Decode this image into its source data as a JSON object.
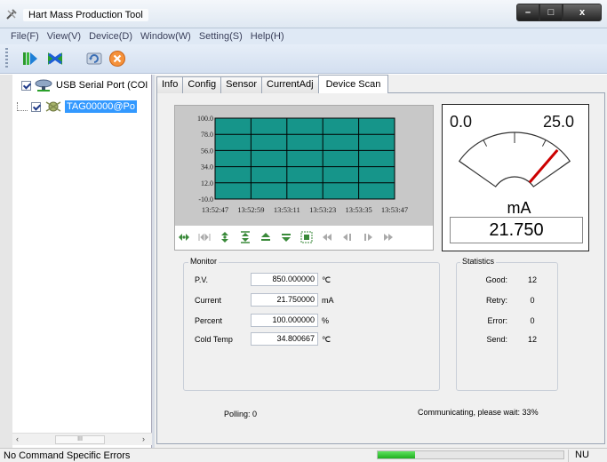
{
  "window": {
    "title": "Hart Mass Production Tool",
    "min": "–",
    "max": "□",
    "close": "x"
  },
  "menu": [
    "File(F)",
    "View(V)",
    "Device(D)",
    "Window(W)",
    "Setting(S)",
    "Help(H)"
  ],
  "toolbar": {
    "icons": [
      "connect-icon",
      "disconnect-icon",
      "refresh-icon",
      "stop-icon"
    ]
  },
  "tree": {
    "port": "USB Serial Port (COI",
    "device": "TAG00000@Po",
    "scroll_thumb": "III"
  },
  "tabs": [
    {
      "label": "Info"
    },
    {
      "label": "Config"
    },
    {
      "label": "Sensor"
    },
    {
      "label": "CurrentAdj"
    },
    {
      "label": "Device Scan"
    }
  ],
  "active_tab": 4,
  "chart_data": {
    "type": "area",
    "y_ticks": [
      "100.0",
      "78.0",
      "56.0",
      "34.0",
      "12.0",
      "-10.0"
    ],
    "x_ticks": [
      "13:52:47",
      "13:52:59",
      "13:53:11",
      "13:53:23",
      "13:53:35",
      "13:53:47"
    ],
    "ylim": [
      -10.0,
      100.0
    ],
    "grid": true,
    "fill_color": "#16958a",
    "series": [
      {
        "values": [
          100.0,
          100.0,
          100.0,
          100.0,
          100.0,
          100.0
        ]
      }
    ]
  },
  "gauge": {
    "min": "0.0",
    "max": "25.0",
    "unit": "mA",
    "value": "21.750",
    "value_num": 21.75,
    "needle_color": "#cc0000"
  },
  "monitor": {
    "title": "Monitor",
    "rows": [
      {
        "label": "P.V.",
        "value": "850.000000",
        "unit": "℃"
      },
      {
        "label": "Current",
        "value": "21.750000",
        "unit": "mA"
      },
      {
        "label": "Percent",
        "value": "100.000000",
        "unit": "%"
      },
      {
        "label": "Cold Temp",
        "value": "34.800667",
        "unit": "℃"
      }
    ]
  },
  "statistics": {
    "title": "Statistics",
    "rows": [
      {
        "label": "Good:",
        "value": "12"
      },
      {
        "label": "Retry:",
        "value": "0"
      },
      {
        "label": "Error:",
        "value": "0"
      },
      {
        "label": "Send:",
        "value": "12"
      }
    ]
  },
  "polling": "Polling: 0",
  "comm": "Communicating, please wait: 33%",
  "status": {
    "message": "No Command Specific Errors",
    "progress": 0.2,
    "indicator": "NU"
  }
}
